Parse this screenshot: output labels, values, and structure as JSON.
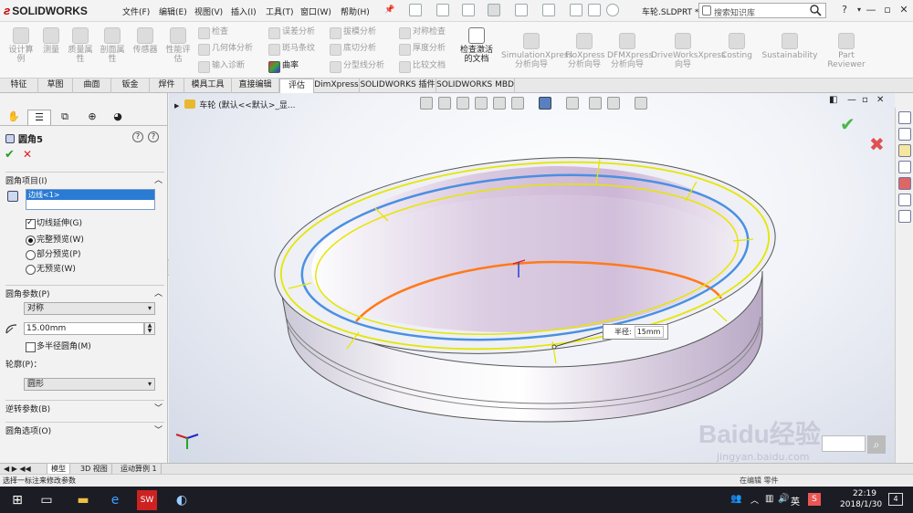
{
  "app": {
    "logo": "SOLIDWORKS",
    "menus": [
      "文件(F)",
      "编辑(E)",
      "视图(V)",
      "插入(I)",
      "工具(T)",
      "窗口(W)",
      "帮助(H)"
    ],
    "filename": "车轮.SLDPRT *",
    "search_placeholder": "搜索知识库"
  },
  "ribbon": {
    "large_buttons": [
      {
        "label": "设计算例"
      },
      {
        "label": "测量"
      },
      {
        "label": "质量属性"
      },
      {
        "label": "剖面属性"
      },
      {
        "label": "传感器"
      },
      {
        "label": "性能评估"
      },
      {
        "label": "检查激活的文档"
      },
      {
        "label": "SimulationXpress 分析向导"
      },
      {
        "label": "FloXpress 分析向导"
      },
      {
        "label": "DFMXpress 分析向导"
      },
      {
        "label": "DriveWorksXpress 向导"
      },
      {
        "label": "Costing"
      },
      {
        "label": "Sustainability"
      },
      {
        "label": "Part Reviewer"
      }
    ],
    "small_buttons": [
      {
        "label": "检查"
      },
      {
        "label": "几何体分析"
      },
      {
        "label": "输入诊断"
      },
      {
        "label": "误差分析"
      },
      {
        "label": "斑马条纹"
      },
      {
        "label": "曲率"
      },
      {
        "label": "拔模分析"
      },
      {
        "label": "底切分析"
      },
      {
        "label": "分型线分析"
      },
      {
        "label": "对称检查"
      },
      {
        "label": "厚度分析"
      },
      {
        "label": "比较文档"
      }
    ]
  },
  "tabs": [
    "特征",
    "草图",
    "曲面",
    "钣金",
    "焊件",
    "模具工具",
    "直接编辑",
    "评估",
    "DimXpress",
    "SOLIDWORKS 插件",
    "SOLIDWORKS MBD"
  ],
  "active_tab_index": 7,
  "property_manager": {
    "title": "圆角5",
    "items_group": {
      "header": "圆角项目(I)",
      "selection": "边线<1>",
      "tangent_propagation": "切线延伸(G)",
      "full_preview": "完整预览(W)",
      "partial_preview": "部分预览(P)",
      "no_preview": "无预览(W)"
    },
    "params_group": {
      "header": "圆角参数(P)",
      "type": "对称",
      "radius": "15.00mm",
      "multi_radius": "多半径圆角(M)",
      "profile_label": "轮廓(P)：",
      "profile": "圆形"
    },
    "reverse_group": "逆转参数(B)",
    "options_group": "圆角选项(O)"
  },
  "viewport": {
    "breadcrumb": "车轮 (默认<<默认>_显...",
    "callout_label": "半径:",
    "callout_value": "15mm",
    "watermark": "Baidu经验",
    "watermark_sub": "jingyan.baidu.com"
  },
  "bottom_tabs": [
    "模型",
    "3D 视图",
    "运动算例 1"
  ],
  "active_bottom_tab": 0,
  "status": {
    "left": "选择一标注来修改参数",
    "right": "在编辑 零件"
  },
  "taskbar": {
    "ime": "英",
    "time": "22:19",
    "date": "2018/1/30",
    "notifications": "4"
  },
  "colors": {
    "edge_selected": "#4a90e2",
    "edge_yellow": "#e6e600",
    "edge_orange": "#ff7a1a",
    "accent_blue": "#2a7bd4"
  }
}
